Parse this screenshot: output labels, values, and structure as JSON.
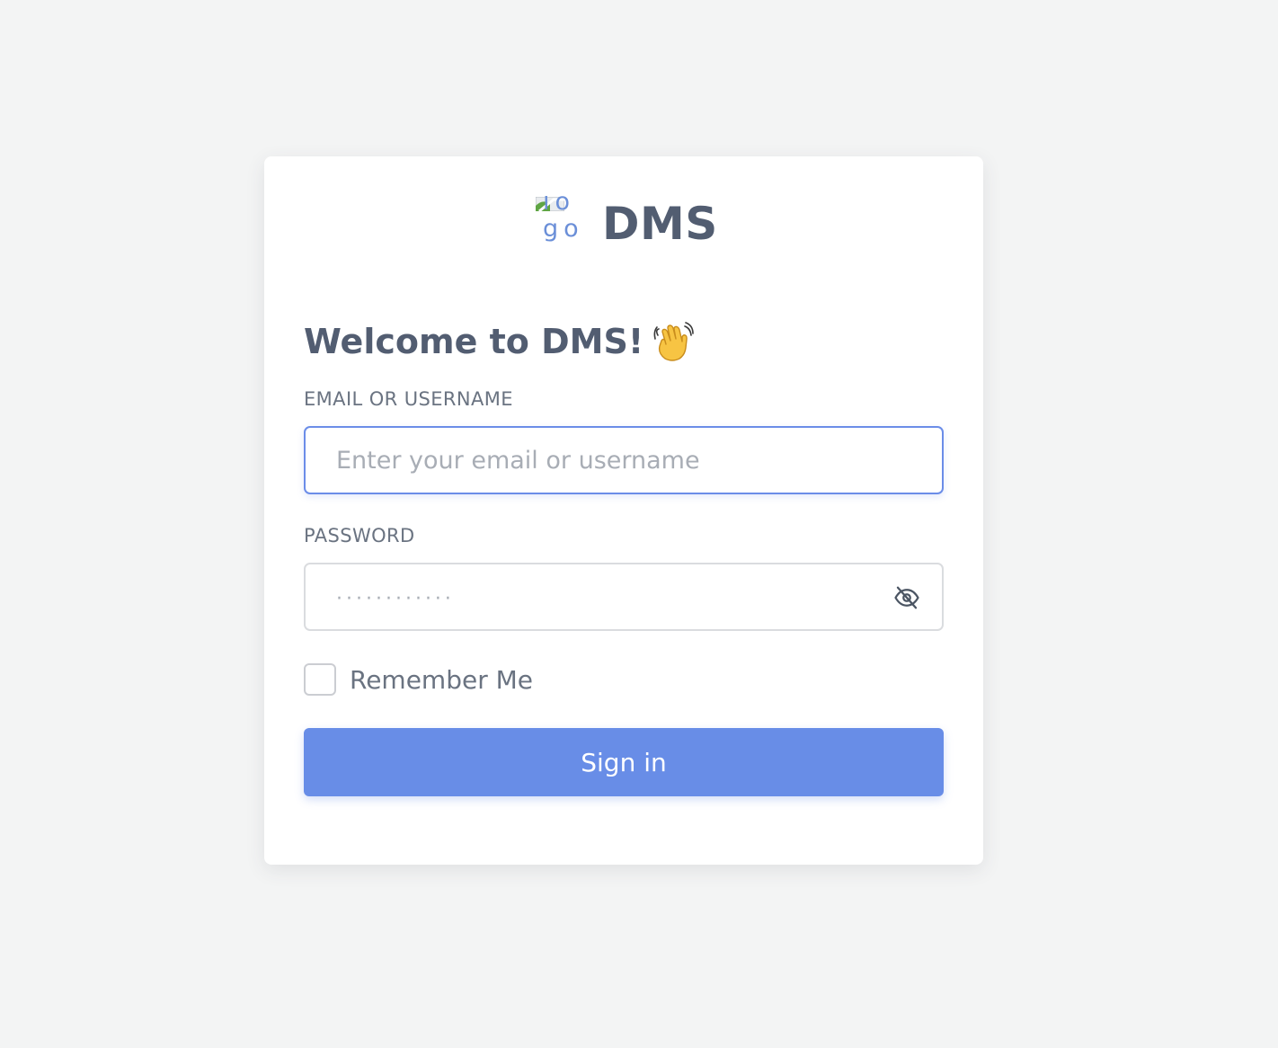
{
  "brand": {
    "logo_alt": "logo",
    "name": "DMS",
    "logo_icon": "broken-image-icon"
  },
  "welcome": {
    "title": "Welcome to DMS!",
    "emoji_icon": "waving-hand-icon"
  },
  "form": {
    "email": {
      "label": "EMAIL OR USERNAME",
      "placeholder": "Enter your email or username",
      "value": ""
    },
    "password": {
      "label": "PASSWORD",
      "placeholder": "············",
      "value": "",
      "toggle_icon": "eye-slash-icon"
    },
    "remember": {
      "label": "Remember Me",
      "checked": false
    },
    "submit_label": "Sign in"
  },
  "colors": {
    "page_background": "#f3f4f4",
    "card_background": "#ffffff",
    "primary": "#688de7",
    "heading_text": "#525d71",
    "label_text": "#6a7381",
    "placeholder_text": "#a8adb5",
    "input_focus_border": "#6b8de8",
    "input_border": "#dadcdf"
  }
}
